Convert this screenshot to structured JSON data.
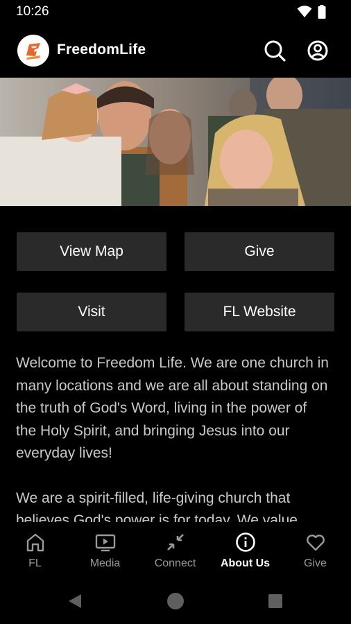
{
  "status": {
    "time": "10:26"
  },
  "header": {
    "title": "FreedomLife"
  },
  "hero": {
    "icon": "hero-photo"
  },
  "actions": [
    {
      "label": "View Map"
    },
    {
      "label": "Give"
    },
    {
      "label": "Visit"
    },
    {
      "label": "FL Website"
    }
  ],
  "content": {
    "paragraphs": [
      "Welcome to Freedom Life. We are one church in many locations and we are all about standing on the truth of God's Word, living in the power of the Holy Spirit, and bringing Jesus into our everyday lives!",
      "We are a spirit-filled, life-giving church that believes God's power is for today. We value"
    ]
  },
  "nav": {
    "items": [
      {
        "label": "FL",
        "icon": "home-icon"
      },
      {
        "label": "Media",
        "icon": "tv-icon"
      },
      {
        "label": "Connect",
        "icon": "connect-icon"
      },
      {
        "label": "About Us",
        "icon": "info-icon",
        "active": true
      },
      {
        "label": "Give",
        "icon": "heart-icon"
      }
    ]
  },
  "colors": {
    "background": "#000000",
    "button": "#2a2a2a",
    "logo_accent": "#e8652b"
  }
}
